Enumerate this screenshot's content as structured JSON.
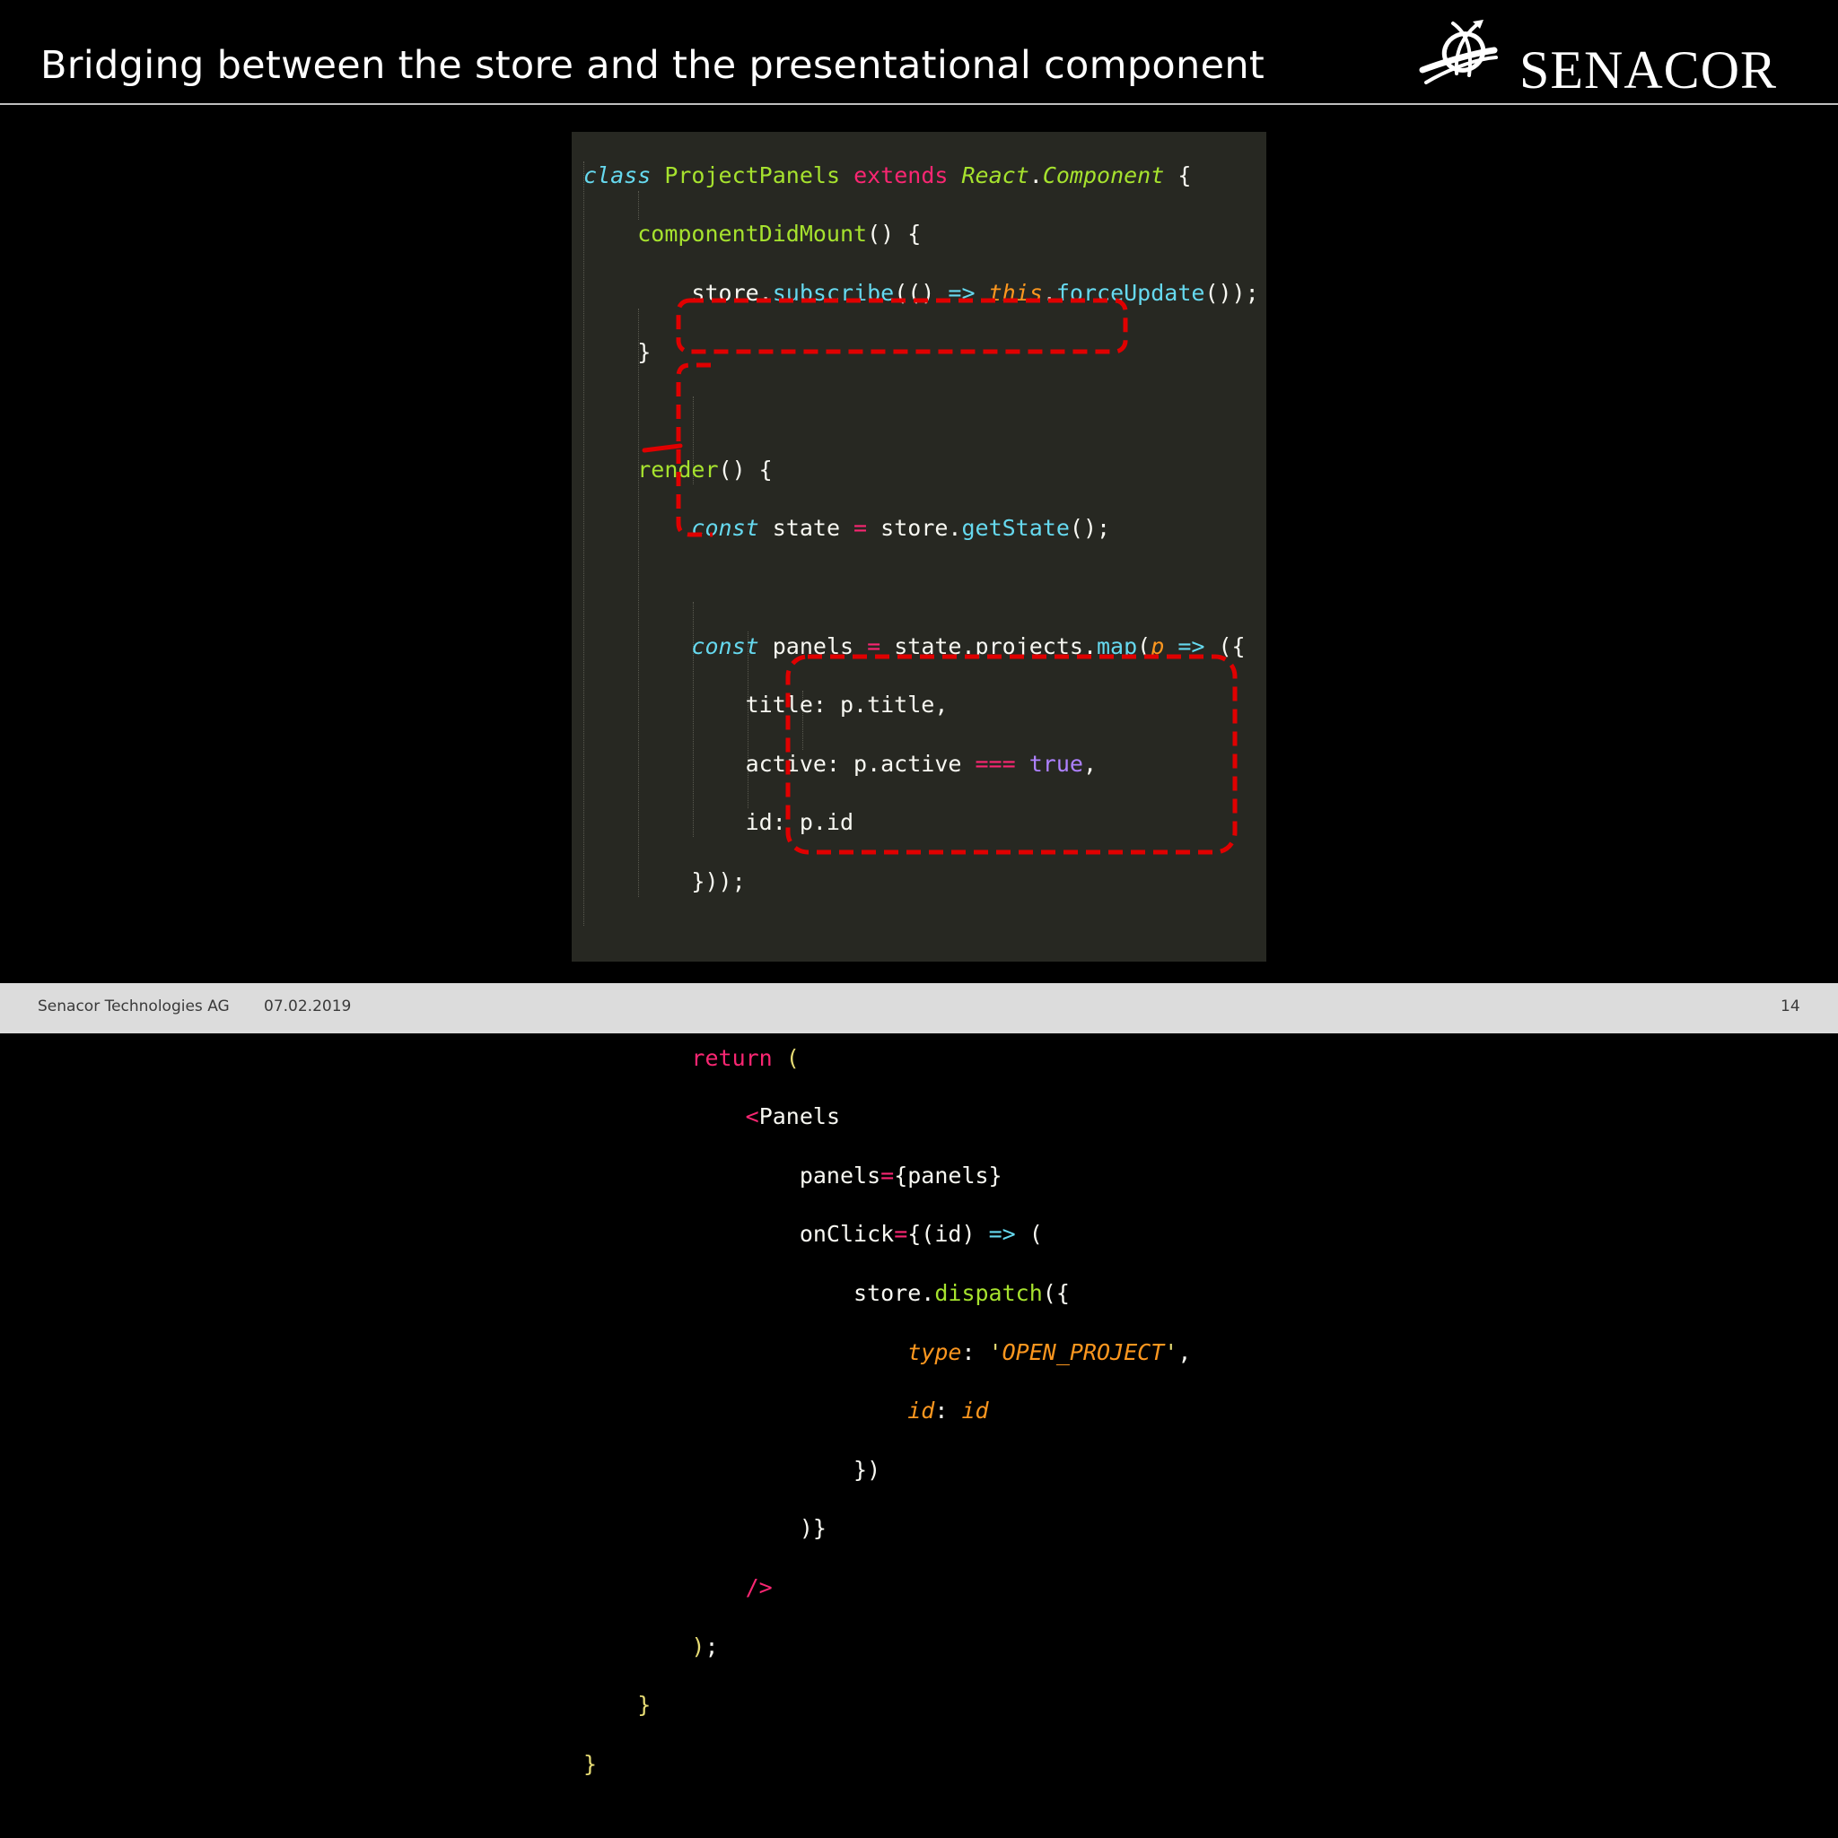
{
  "slide": {
    "title": "Bridging between the store and the presentational component"
  },
  "logo": {
    "text": "SENACOR",
    "icon": "senacor-swirl-icon"
  },
  "code": {
    "language": "jsx",
    "lines": [
      "class ProjectPanels extends React.Component {",
      "    componentDidMount() {",
      "        store.subscribe(() => this.forceUpdate());",
      "    }",
      "",
      "    render() {",
      "        const state = store.getState();",
      "",
      "        const panels = state.projects.map(p => ({",
      "            title: p.title,",
      "            active: p.active === true,",
      "            id: p.id",
      "        }));",
      "",
      "",
      "        return (",
      "            <Panels",
      "                panels={panels}",
      "                onClick={(id) => (",
      "                    store.dispatch({",
      "                        type: 'OPEN_PROJECT',",
      "                        id: id",
      "                    })",
      "                )}",
      "            />",
      "        );",
      "    }",
      "}"
    ]
  },
  "annotations": [
    {
      "label": "highlight-get-state",
      "color": "#e00000",
      "style": "dashed"
    },
    {
      "label": "highlight-panels-map",
      "color": "#e00000",
      "style": "dashed bracket"
    },
    {
      "label": "highlight-on-click-dispatch",
      "color": "#e00000",
      "style": "dashed"
    }
  ],
  "footer": {
    "company": "Senacor Technologies AG",
    "date": "07.02.2019",
    "page": "14"
  }
}
